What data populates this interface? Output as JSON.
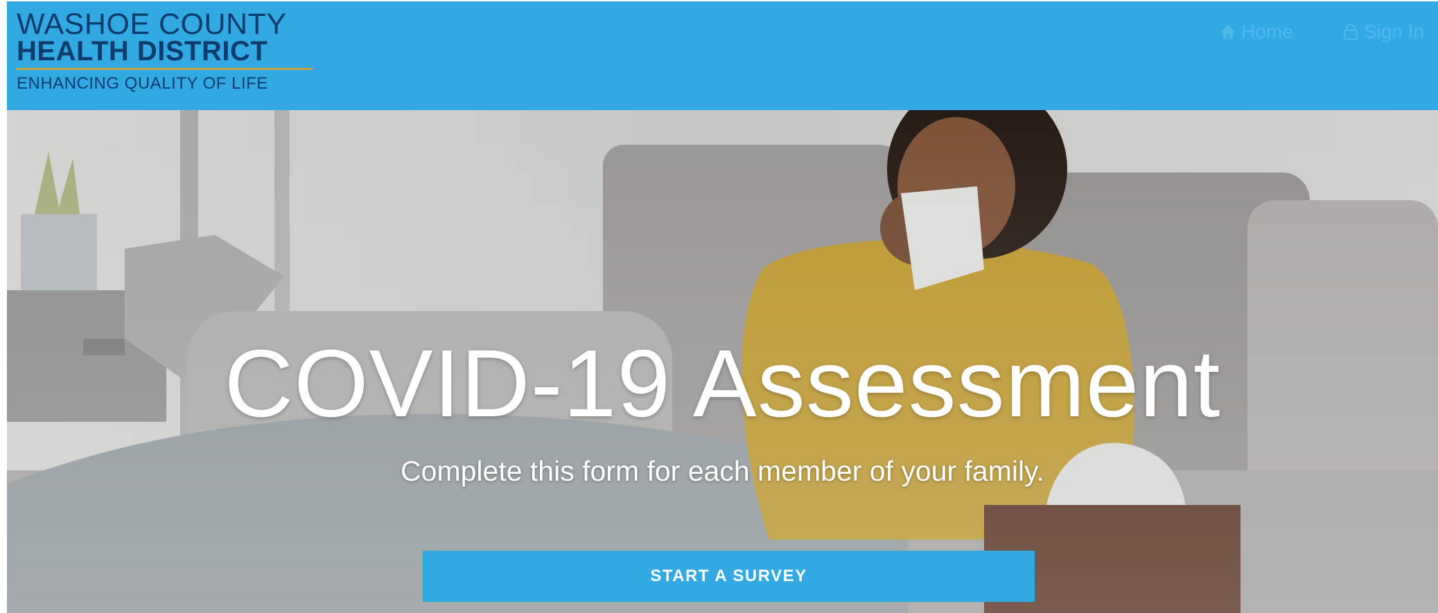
{
  "header": {
    "logo": {
      "line1": "WASHOE COUNTY",
      "line2": "HEALTH DISTRICT",
      "tagline": "ENHANCING QUALITY OF LIFE"
    },
    "nav": {
      "home": {
        "label": "Home",
        "icon": "home-icon"
      },
      "sign_in": {
        "label": "Sign In",
        "icon": "lock-icon"
      }
    }
  },
  "hero": {
    "title": "COVID-19 Assessment",
    "subtitle": "Complete this form for each member of your family.",
    "cta_label": "START A SURVEY"
  },
  "colors": {
    "header_bg": "#33a9e3",
    "logo_text": "#0d3c6e",
    "logo_rule": "#c9a23a",
    "cta_bg": "#33a9e3",
    "cta_text": "#ffffff"
  }
}
